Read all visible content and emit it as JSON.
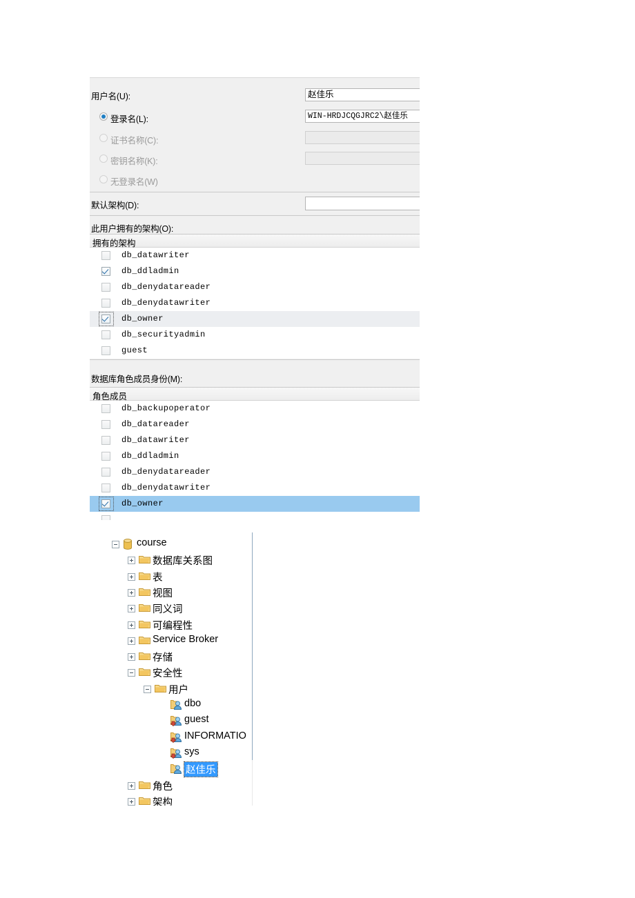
{
  "dialog": {
    "fields": [
      {
        "id": "user-name",
        "label": "用户名(U):",
        "value": "赵佳乐",
        "disabled": false,
        "kind": "text"
      },
      {
        "id": "login-name",
        "label": "登录名(L):",
        "value": "WIN-HRDJCQGJRC2\\赵佳乐",
        "disabled": false,
        "kind": "radio",
        "checked": true
      },
      {
        "id": "cert-name",
        "label": "证书名称(C):",
        "value": "",
        "disabled": true,
        "kind": "radio",
        "checked": false
      },
      {
        "id": "key-name",
        "label": "密钥名称(K):",
        "value": "",
        "disabled": true,
        "kind": "radio",
        "checked": false
      },
      {
        "id": "no-login",
        "label": "无登录名(W)",
        "value": null,
        "disabled": true,
        "kind": "radio",
        "checked": false
      },
      {
        "id": "default-schema",
        "label": "默认架构(D):",
        "value": "",
        "disabled": false,
        "kind": "text"
      }
    ],
    "schemas_section": {
      "caption": "此用户拥有的架构(O):",
      "column_header": "拥有的架构",
      "rows": [
        {
          "name": "db_datawriter",
          "checked": false,
          "highlight": "none"
        },
        {
          "name": "db_ddladmin",
          "checked": true,
          "highlight": "none"
        },
        {
          "name": "db_denydatareader",
          "checked": false,
          "highlight": "none"
        },
        {
          "name": "db_denydatawriter",
          "checked": false,
          "highlight": "none"
        },
        {
          "name": "db_owner",
          "checked": true,
          "highlight": "gray",
          "focused": true
        },
        {
          "name": "db_securityadmin",
          "checked": false,
          "highlight": "none"
        },
        {
          "name": "guest",
          "checked": false,
          "highlight": "none"
        }
      ]
    },
    "roles_section": {
      "caption": "数据库角色成员身份(M):",
      "column_header": "角色成员",
      "rows": [
        {
          "name": "db_backupoperator",
          "checked": false,
          "highlight": "none"
        },
        {
          "name": "db_datareader",
          "checked": false,
          "highlight": "none"
        },
        {
          "name": "db_datawriter",
          "checked": false,
          "highlight": "none"
        },
        {
          "name": "db_ddladmin",
          "checked": false,
          "highlight": "none"
        },
        {
          "name": "db_denydatareader",
          "checked": false,
          "highlight": "none"
        },
        {
          "name": "db_denydatawriter",
          "checked": false,
          "highlight": "none"
        },
        {
          "name": "db_owner",
          "checked": true,
          "highlight": "blue",
          "focused": true
        }
      ]
    }
  },
  "tree": {
    "nodes": [
      {
        "label": "course",
        "depth": 0,
        "expander": "minus",
        "icon": "database-icon",
        "selected": false
      },
      {
        "label": "数据库关系图",
        "depth": 1,
        "expander": "plus",
        "icon": "folder-icon",
        "selected": false
      },
      {
        "label": "表",
        "depth": 1,
        "expander": "plus",
        "icon": "folder-icon",
        "selected": false
      },
      {
        "label": "视图",
        "depth": 1,
        "expander": "plus",
        "icon": "folder-icon",
        "selected": false
      },
      {
        "label": "同义词",
        "depth": 1,
        "expander": "plus",
        "icon": "folder-icon",
        "selected": false
      },
      {
        "label": "可编程性",
        "depth": 1,
        "expander": "plus",
        "icon": "folder-icon",
        "selected": false
      },
      {
        "label": "Service Broker",
        "depth": 1,
        "expander": "plus",
        "icon": "folder-icon",
        "selected": false
      },
      {
        "label": "存储",
        "depth": 1,
        "expander": "plus",
        "icon": "folder-icon",
        "selected": false
      },
      {
        "label": "安全性",
        "depth": 1,
        "expander": "minus",
        "icon": "folder-icon",
        "selected": false
      },
      {
        "label": "用户",
        "depth": 2,
        "expander": "minus",
        "icon": "folder-icon",
        "selected": false
      },
      {
        "label": "dbo",
        "depth": 3,
        "expander": "none",
        "icon": "user-icon",
        "selected": false
      },
      {
        "label": "guest",
        "depth": 3,
        "expander": "none",
        "icon": "user-down-icon",
        "selected": false
      },
      {
        "label": "INFORMATIO",
        "depth": 3,
        "expander": "none",
        "icon": "user-down-icon",
        "selected": false
      },
      {
        "label": "sys",
        "depth": 3,
        "expander": "none",
        "icon": "user-down-icon",
        "selected": false
      },
      {
        "label": "赵佳乐",
        "depth": 3,
        "expander": "none",
        "icon": "user-icon",
        "selected": true
      },
      {
        "label": "角色",
        "depth": 1,
        "expander": "plus",
        "icon": "folder-icon",
        "selected": false
      },
      {
        "label": "架构",
        "depth": 1,
        "expander": "plus",
        "icon": "folder-icon",
        "selected": false
      }
    ]
  },
  "colors": {
    "dialog_bg": "#f0f0f0",
    "selection_blue": "#99caef",
    "selection_gray": "#eceef1",
    "tree_selection": "#3399ff",
    "checkbox_check": "#2a6ea8",
    "radio_dot": "#1f7fc4",
    "folder": "#f5c86a",
    "database": "#e8b73e"
  }
}
